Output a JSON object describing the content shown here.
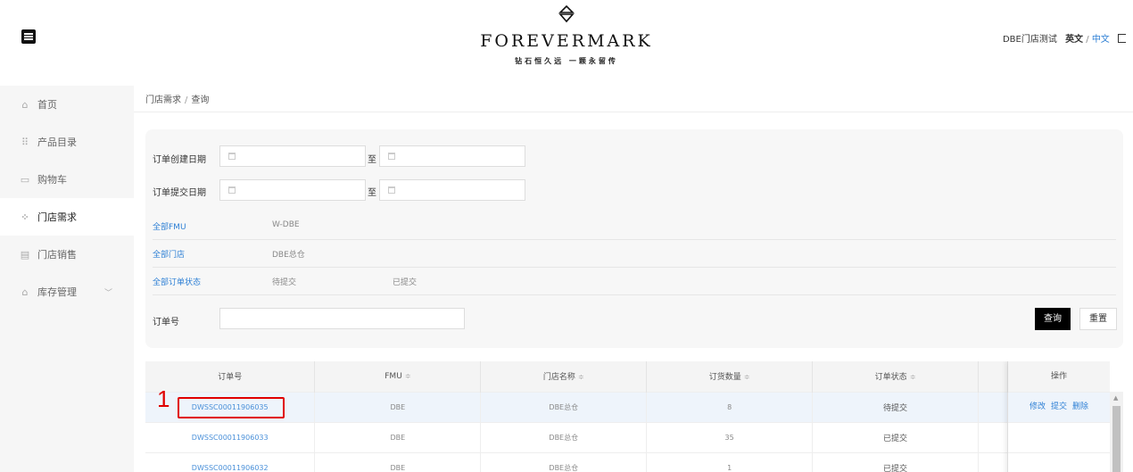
{
  "header": {
    "brand": "FOREVERMARK",
    "tagline": "钻石恒久远 一颗永留传",
    "user_name": "DBE门店测试",
    "lang_en": "英文",
    "lang_sep": "/",
    "lang_zh": "中文",
    "icons": {
      "menu": "menu-icon",
      "logo": "diamond-logo-icon",
      "logout": "logout-icon"
    }
  },
  "sidebar": {
    "items": [
      {
        "label": "首页",
        "icon": "⌂"
      },
      {
        "label": "产品目录",
        "icon": "⠿"
      },
      {
        "label": "购物车",
        "icon": "▭"
      },
      {
        "label": "门店需求",
        "icon": "⁘"
      },
      {
        "label": "门店销售",
        "icon": "▤"
      },
      {
        "label": "库存管理",
        "icon": "⌂",
        "caret": "﹀"
      }
    ],
    "active_index": 3
  },
  "breadcrumb": {
    "parent": "门店需求",
    "sep": "/",
    "current": "查询"
  },
  "filters": {
    "create_date_label": "订单创建日期",
    "submit_date_label": "订单提交日期",
    "to_label": "至",
    "fmu": {
      "label": "全部FMU",
      "options": [
        "W-DBE"
      ]
    },
    "store": {
      "label": "全部门店",
      "options": [
        "DBE总仓"
      ]
    },
    "status": {
      "label": "全部订单状态",
      "options": [
        "待提交",
        "已提交"
      ]
    },
    "order_no_label": "订单号",
    "order_no_value": "",
    "search_label": "查询",
    "reset_label": "重置"
  },
  "table": {
    "columns": [
      "订单号",
      "FMU",
      "门店名称",
      "订货数量",
      "订单状态"
    ],
    "sort_icon": "≑",
    "operation_header": "操作",
    "rows": [
      {
        "order_no": "DWSSC000119060​35",
        "fmu": "DBE",
        "store": "DBE总仓",
        "qty": "8",
        "status": "待提交"
      },
      {
        "order_no": "DWSSC00011906033",
        "fmu": "DBE",
        "store": "DBE总仓",
        "qty": "35",
        "status": "已提交"
      },
      {
        "order_no": "DWSSC00011906032",
        "fmu": "DBE",
        "store": "DBE总仓",
        "qty": "1",
        "status": "已提交"
      }
    ],
    "actions": {
      "edit": "修改",
      "submit": "提交",
      "delete": "删除"
    }
  },
  "annotation": {
    "number": "1",
    "color": "#e00000"
  },
  "colors": {
    "accent": "#2f80d5",
    "highlight_row": "#eef4fb",
    "primary_button": "#000000"
  }
}
